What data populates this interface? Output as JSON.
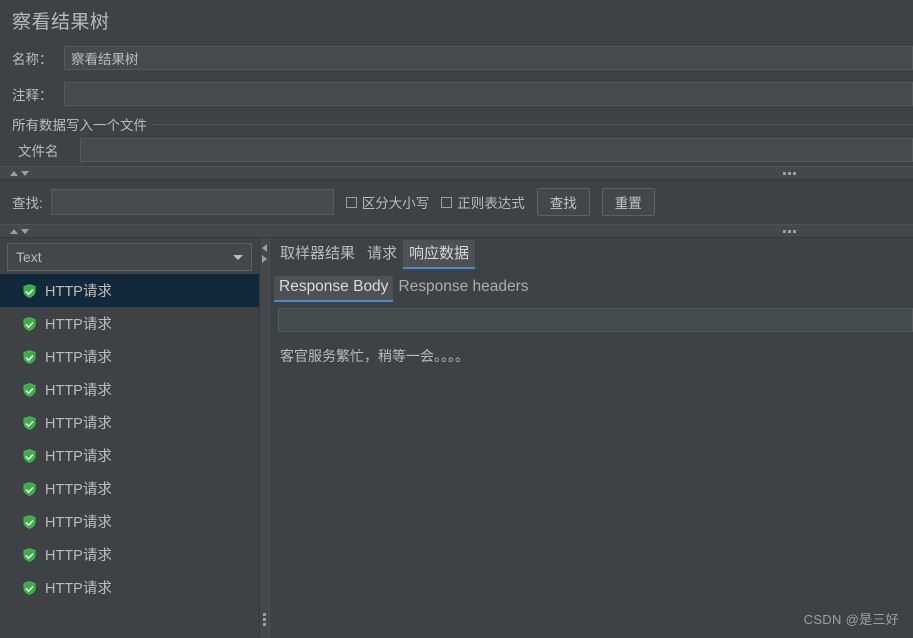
{
  "window": {
    "title": "察看结果树"
  },
  "form": {
    "name_label": "名称：",
    "name_value": "察看结果树",
    "comment_label": "注释：",
    "comment_value": "",
    "group_title": "所有数据写入一个文件",
    "filename_label": "文件名",
    "filename_value": ""
  },
  "find": {
    "label": "查找:",
    "value": "",
    "case_sensitive_label": "区分大小写",
    "regex_label": "正则表达式",
    "find_button": "查找",
    "reset_button": "重置"
  },
  "left_panel": {
    "renderer": "Text",
    "tree_items": [
      {
        "label": "HTTP请求",
        "status": "success",
        "selected": true
      },
      {
        "label": "HTTP请求",
        "status": "success",
        "selected": false
      },
      {
        "label": "HTTP请求",
        "status": "success",
        "selected": false
      },
      {
        "label": "HTTP请求",
        "status": "success",
        "selected": false
      },
      {
        "label": "HTTP请求",
        "status": "success",
        "selected": false
      },
      {
        "label": "HTTP请求",
        "status": "success",
        "selected": false
      },
      {
        "label": "HTTP请求",
        "status": "success",
        "selected": false
      },
      {
        "label": "HTTP请求",
        "status": "success",
        "selected": false
      },
      {
        "label": "HTTP请求",
        "status": "success",
        "selected": false
      },
      {
        "label": "HTTP请求",
        "status": "success",
        "selected": false
      }
    ]
  },
  "right_panel": {
    "tabs": [
      {
        "label": "取样器结果",
        "active": false
      },
      {
        "label": "请求",
        "active": false
      },
      {
        "label": "响应数据",
        "active": true
      }
    ],
    "subtabs": [
      {
        "label": "Response Body",
        "active": true
      },
      {
        "label": "Response headers",
        "active": false
      }
    ],
    "search_value": "",
    "body_text": "客官服务繁忙，稍等一会。。。。"
  },
  "watermark": "CSDN @是三好",
  "colors": {
    "background": "#3f4245",
    "selection": "#12293c",
    "accent": "#4a88d6",
    "status_success": "#3fbf4a",
    "text": "#b9bcbd"
  }
}
